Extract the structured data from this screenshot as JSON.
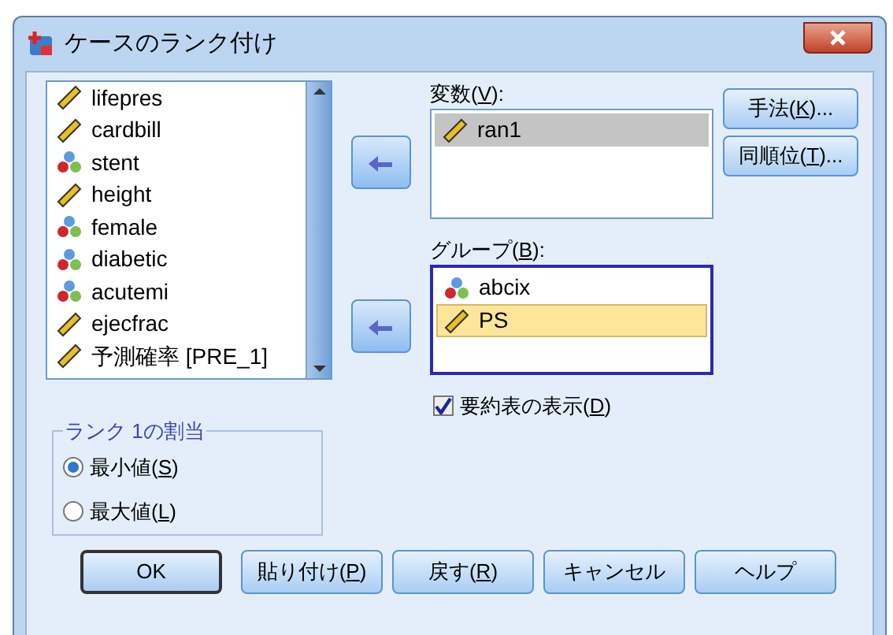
{
  "window": {
    "title": "ケースのランク付け"
  },
  "source_list": {
    "items": [
      {
        "kind": "scale",
        "label": "lifepres",
        "selected": false
      },
      {
        "kind": "scale",
        "label": "cardbill",
        "selected": false
      },
      {
        "kind": "nominal",
        "label": "stent",
        "selected": false
      },
      {
        "kind": "scale",
        "label": "height",
        "selected": false
      },
      {
        "kind": "nominal",
        "label": "female",
        "selected": false
      },
      {
        "kind": "nominal",
        "label": "diabetic",
        "selected": false
      },
      {
        "kind": "nominal",
        "label": "acutemi",
        "selected": false
      },
      {
        "kind": "scale",
        "label": "ejecfrac",
        "selected": false
      },
      {
        "kind": "scale",
        "label": "予測確率 [PRE_1]",
        "selected": false
      }
    ]
  },
  "variables": {
    "label": {
      "before": "変数(",
      "key": "V",
      "after": "):"
    },
    "focused": false,
    "items": [
      {
        "kind": "scale",
        "label": "ran1",
        "selected": true
      }
    ]
  },
  "groups": {
    "label": {
      "before": "グループ(",
      "key": "B",
      "after": "):"
    },
    "focused": true,
    "items": [
      {
        "kind": "nominal",
        "label": "abcix",
        "selected": false
      },
      {
        "kind": "scale",
        "label": "PS",
        "selected": true
      }
    ]
  },
  "side_buttons": [
    {
      "before": "手法(",
      "key": "K",
      "after": ")..."
    },
    {
      "before": "同順位(",
      "key": "T",
      "after": ")..."
    }
  ],
  "summary_checkbox": {
    "label": {
      "before": "要約表の表示(",
      "key": "D",
      "after": ")"
    },
    "checked": true
  },
  "rank1_group": {
    "title": "ランク 1の割当",
    "options": [
      {
        "label": {
          "before": "最小値(",
          "key": "S",
          "after": ")"
        },
        "selected": true
      },
      {
        "label": {
          "before": "最大値(",
          "key": "L",
          "after": ")"
        },
        "selected": false
      }
    ]
  },
  "buttons": [
    {
      "label": {
        "before": "OK"
      },
      "default": true
    },
    {
      "label": {
        "before": "貼り付け(",
        "key": "P",
        "after": ")"
      },
      "default": false
    },
    {
      "label": {
        "before": "戻す(",
        "key": "R",
        "after": ")"
      },
      "default": false
    },
    {
      "label": {
        "before": "キャンセル"
      },
      "default": false
    },
    {
      "label": {
        "before": "ヘルプ"
      },
      "default": false
    }
  ]
}
